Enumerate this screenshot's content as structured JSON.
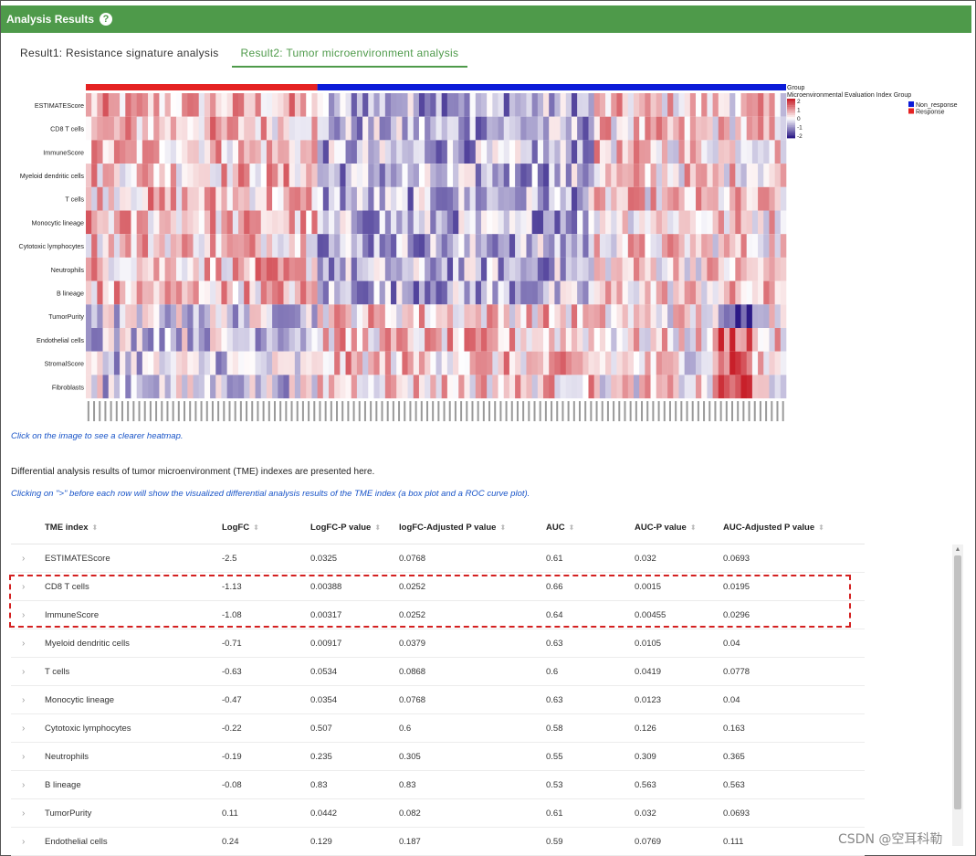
{
  "header": {
    "title": "Analysis Results",
    "help_glyph": "?"
  },
  "tabs": [
    {
      "label": "Result1: Resistance signature analysis",
      "active": false
    },
    {
      "label": "Result2: Tumor microenvironment analysis",
      "active": true
    }
  ],
  "heatmap": {
    "row_labels": [
      "ESTIMATEScore",
      "CD8 T cells",
      "ImmuneScore",
      "Myeloid dendritic cells",
      "T cells",
      "Monocytic lineage",
      "Cytotoxic lymphocytes",
      "Neutrophils",
      "B lineage",
      "TumorPurity",
      "Endothelial cells",
      "StromalScore",
      "Fibroblasts"
    ],
    "legend": {
      "group_title": "Group",
      "index_title": "Microenvironmental Evaluation Index Group",
      "scale_ticks": [
        "2",
        "1",
        "0",
        "-1",
        "-2"
      ],
      "groups": [
        {
          "label": "Non_response",
          "color": "#0b1bd8"
        },
        {
          "label": "Response",
          "color": "#e52222"
        }
      ]
    },
    "colors": {
      "high": "#c8202a",
      "mid": "#ffffff",
      "low": "#2c1a86"
    }
  },
  "hints": {
    "click_image": "Click on the image to see a clearer heatmap.",
    "description": "Differential analysis results of tumor microenvironment (TME) indexes are presented here.",
    "click_row": "Clicking on \">\" before each row will show the visualized differential analysis results of the TME index (a box plot and a ROC curve plot)."
  },
  "table": {
    "columns": [
      "TME index",
      "LogFC",
      "LogFC-P value",
      "logFC-Adjusted P value",
      "AUC",
      "AUC-P value",
      "AUC-Adjusted P value"
    ],
    "sort_glyph": "⬍",
    "expand_glyph": "›",
    "rows": [
      [
        "ESTIMATEScore",
        "-2.5",
        "0.0325",
        "0.0768",
        "0.61",
        "0.032",
        "0.0693"
      ],
      [
        "CD8 T cells",
        "-1.13",
        "0.00388",
        "0.0252",
        "0.66",
        "0.0015",
        "0.0195"
      ],
      [
        "ImmuneScore",
        "-1.08",
        "0.00317",
        "0.0252",
        "0.64",
        "0.00455",
        "0.0296"
      ],
      [
        "Myeloid dendritic cells",
        "-0.71",
        "0.00917",
        "0.0379",
        "0.63",
        "0.0105",
        "0.04"
      ],
      [
        "T cells",
        "-0.63",
        "0.0534",
        "0.0868",
        "0.6",
        "0.0419",
        "0.0778"
      ],
      [
        "Monocytic lineage",
        "-0.47",
        "0.0354",
        "0.0768",
        "0.63",
        "0.0123",
        "0.04"
      ],
      [
        "Cytotoxic lymphocytes",
        "-0.22",
        "0.507",
        "0.6",
        "0.58",
        "0.126",
        "0.163"
      ],
      [
        "Neutrophils",
        "-0.19",
        "0.235",
        "0.305",
        "0.55",
        "0.309",
        "0.365"
      ],
      [
        "B lineage",
        "-0.08",
        "0.83",
        "0.83",
        "0.53",
        "0.563",
        "0.563"
      ],
      [
        "TumorPurity",
        "0.11",
        "0.0442",
        "0.082",
        "0.61",
        "0.032",
        "0.0693"
      ],
      [
        "Endothelial cells",
        "0.24",
        "0.129",
        "0.187",
        "0.59",
        "0.0769",
        "0.111"
      ]
    ]
  },
  "scrollbar": {
    "up_glyph": "▲"
  },
  "watermark": "CSDN @空耳科勒"
}
